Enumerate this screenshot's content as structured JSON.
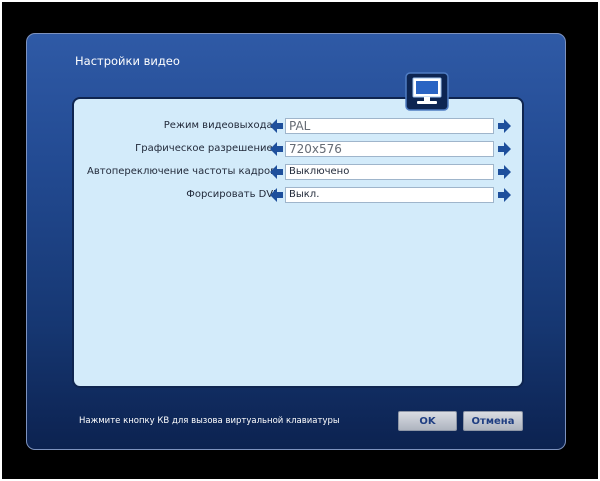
{
  "dialog": {
    "title": "Настройки видео",
    "icon": "monitor-icon"
  },
  "settings": [
    {
      "label": "Режим видеовыхода:",
      "value": "PAL"
    },
    {
      "label": "Графическое разрешение:",
      "value": "720x576"
    },
    {
      "label": "Автопереключение частоты кадров",
      "value": "Выключено"
    },
    {
      "label": "Форсировать DVI",
      "value": "Выкл."
    }
  ],
  "footer": {
    "hint": "Нажмите кнопку КВ для вызова виртуальной клавиатуры",
    "ok_label": "OK",
    "cancel_label": "Отмена"
  },
  "colors": {
    "dialog_blue": "#234b93",
    "panel_bg": "#d3ebfa",
    "arrow_blue": "#1e4f9c",
    "button_text": "#1f3e82"
  }
}
